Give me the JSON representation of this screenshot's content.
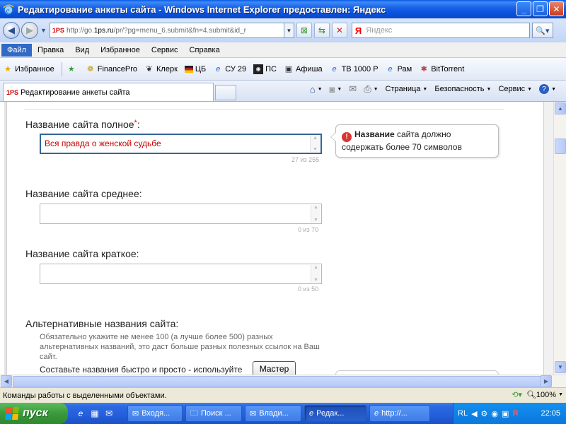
{
  "window": {
    "title": "Редактирование анкеты сайта - Windows Internet Explorer предоставлен: Яндекс"
  },
  "address": {
    "url_prefix": "http://go.",
    "url_domain": "1ps.ru",
    "url_rest": "/pr/?pg=menu_6.submit&fn=4.submit&id_r",
    "site_logo": "1PS",
    "search_placeholder": "Яндекс",
    "search_logo": "Я"
  },
  "menu": {
    "items": [
      "Файл",
      "Правка",
      "Вид",
      "Избранное",
      "Сервис",
      "Справка"
    ]
  },
  "favorites": {
    "label": "Избранное",
    "links": [
      "FinancePro",
      "Клерк",
      "ЦБ",
      "СУ 29",
      "ПС",
      "Афиша",
      "ТВ 1000 Р",
      "Рам",
      "BitTorrent"
    ]
  },
  "tab": {
    "logo": "1PS",
    "title": "Редактирование анкеты сайта"
  },
  "commands": {
    "page": "Страница",
    "safety": "Безопасность",
    "service": "Сервис"
  },
  "form": {
    "full_name": {
      "label": "Название сайта полное",
      "required_mark": "*",
      "suffix": ":",
      "value": "Вся правда о женской судьбе",
      "counter": "27 из 255"
    },
    "medium_name": {
      "label": "Название сайта среднее:",
      "value": "",
      "counter": "0 из 70"
    },
    "short_name": {
      "label": "Название сайта краткое:",
      "value": "",
      "counter": "0 из 50"
    },
    "alt_names": {
      "label": "Альтернативные названия сайта:",
      "hint": "Обязательно укажите не менее 100 (а лучше более 500) разных альтернативных названий, это даст больше разных полезных ссылок на Ваш сайт.",
      "compose_text": "Составьте названия быстро и просто - используйте",
      "master_button": "Мастер"
    }
  },
  "tooltip": {
    "bold": "Название",
    "text": " сайта должно содержать более 70 символов"
  },
  "status": {
    "text": "Команды работы с выделенными объектами.",
    "zoom": "100%"
  },
  "taskbar": {
    "start": "пуск",
    "tasks": [
      "Входя...",
      "Поиск ...",
      "Влади...",
      "Редак...",
      "http://..."
    ],
    "lang": "RL",
    "clock": "22:05"
  },
  "colors": {
    "title_bar": "#0a52dd",
    "taskbar": "#245edb",
    "start": "#3a9a3a",
    "error_red": "#c00"
  }
}
